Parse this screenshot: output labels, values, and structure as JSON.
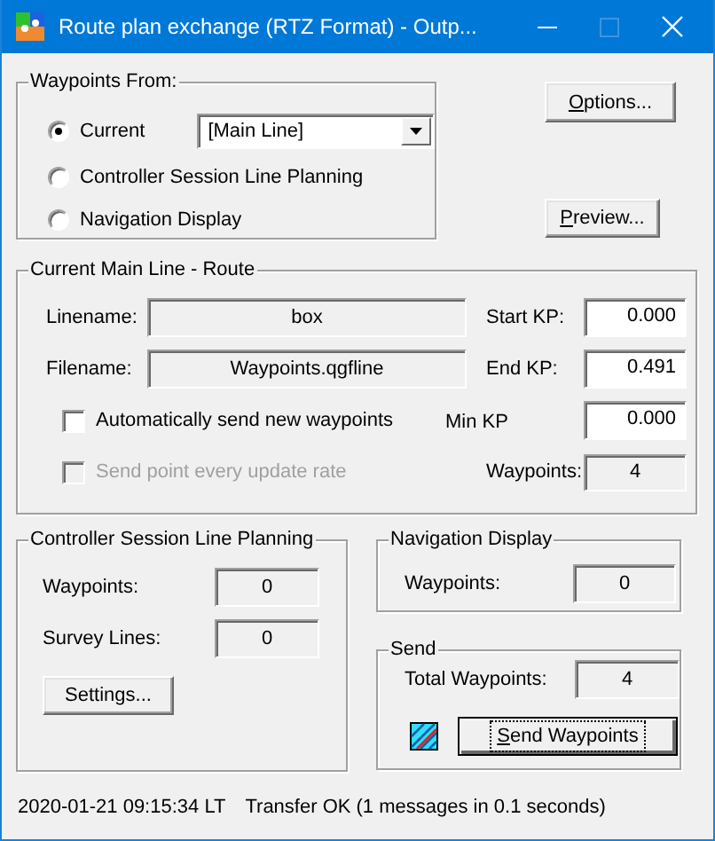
{
  "window": {
    "title": "Route plan exchange (RTZ Format) - Outp..."
  },
  "waypoints_from": {
    "title": "Waypoints From:",
    "options": [
      {
        "label": "Current",
        "selected": true
      },
      {
        "label": "Controller Session Line Planning",
        "selected": false
      },
      {
        "label": "Navigation Display",
        "selected": false
      }
    ],
    "line_select": {
      "value": "[Main Line]"
    }
  },
  "buttons": [
    {
      "label": "Options...",
      "underline_first": true
    },
    {
      "label": "Preview...",
      "underline_first": true
    }
  ],
  "route": {
    "title": "Current Main Line - Route",
    "linename": {
      "label": "Linename:",
      "value": "box"
    },
    "filename": {
      "label": "Filename:",
      "value": "Waypoints.qgfline"
    },
    "start_kp": {
      "label": "Start KP:",
      "value": "0.000"
    },
    "end_kp": {
      "label": "End KP:",
      "value": "0.491"
    },
    "min_kp": {
      "label": "Min KP",
      "value": "0.000"
    },
    "waypoints": {
      "label": "Waypoints:",
      "value": "4"
    },
    "checks": [
      {
        "label": "Automatically send new waypoints",
        "checked": false,
        "disabled": false
      },
      {
        "label": "Send point every update rate",
        "checked": false,
        "disabled": true
      }
    ]
  },
  "controller": {
    "title": "Controller Session Line Planning",
    "rows": [
      {
        "label": "Waypoints:",
        "value": "0"
      },
      {
        "label": "Survey Lines:",
        "value": "0"
      }
    ],
    "button": {
      "label": "Settings...",
      "underline_first": false
    }
  },
  "navigation": {
    "title": "Navigation Display",
    "rows": [
      {
        "label": "Waypoints:",
        "value": "0"
      }
    ]
  },
  "send": {
    "title": "Send",
    "rows": [
      {
        "label": "Total Waypoints:",
        "value": "4"
      }
    ],
    "button": {
      "label": "Send Waypoints",
      "underline_first": true,
      "focused": true
    }
  },
  "status_bar": {
    "time": "2020-01-21 09:15:34 LT",
    "message": "Transfer OK (1 messages in 0.1 seconds)"
  }
}
